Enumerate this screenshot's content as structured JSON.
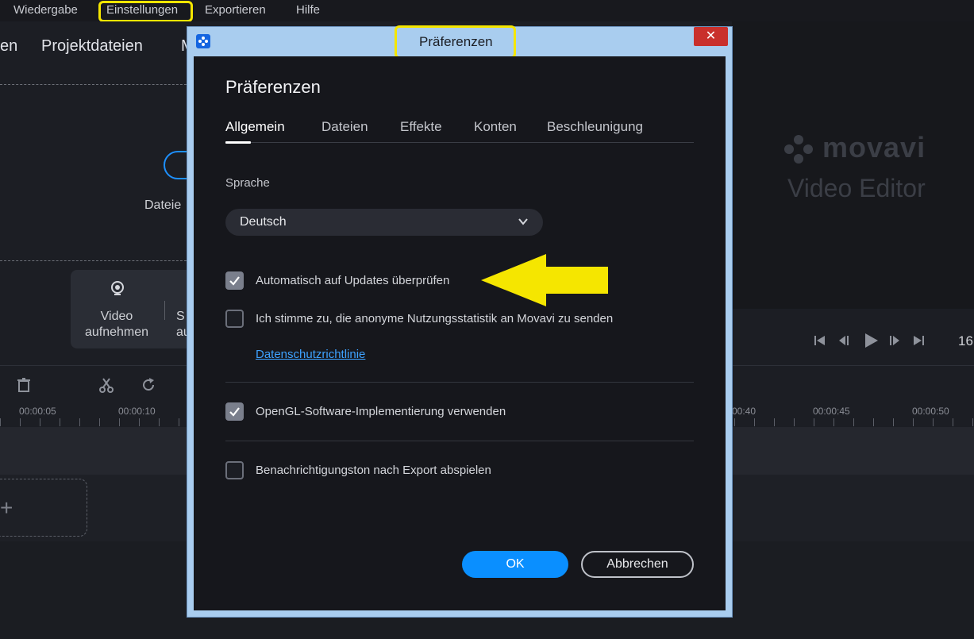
{
  "menubar": {
    "items": [
      "Wiedergabe",
      "Einstellungen",
      "Exportieren",
      "Hilfe"
    ]
  },
  "app": {
    "tabs": [
      "en",
      "Projektdateien",
      "M"
    ],
    "import_label": "Dateie",
    "capture": {
      "video_label": "Video\naufnehmen",
      "screen_label": "S\nau"
    },
    "logo": {
      "brand": "movavi",
      "product": "Video Editor"
    },
    "player_time": "16",
    "timeline_ticks": [
      "00:00:05",
      "00:00:10",
      "00:40",
      "00:00:45",
      "00:00:50"
    ],
    "add_track_symbol": "+"
  },
  "dialog": {
    "window_title": "Präferenzen",
    "close_symbol": "✕",
    "heading": "Präferenzen",
    "tabs": [
      "Allgemein",
      "Dateien",
      "Effekte",
      "Konten",
      "Beschleunigung"
    ],
    "active_tab": "Allgemein",
    "language": {
      "label": "Sprache",
      "value": "Deutsch"
    },
    "options": [
      {
        "label": "Automatisch auf Updates überprüfen",
        "checked": true
      },
      {
        "label": "Ich stimme zu, die anonyme Nutzungsstatistik an Movavi zu senden",
        "checked": false
      },
      {
        "label": "OpenGL-Software-Implementierung verwenden",
        "checked": true
      },
      {
        "label": "Benachrichtigungston nach Export abspielen",
        "checked": false
      }
    ],
    "privacy_link": "Datenschutzrichtlinie",
    "ok_label": "OK",
    "cancel_label": "Abbrechen"
  },
  "colors": {
    "highlight": "#f5e600",
    "accent": "#0a8fff",
    "link": "#3ea2ff"
  }
}
